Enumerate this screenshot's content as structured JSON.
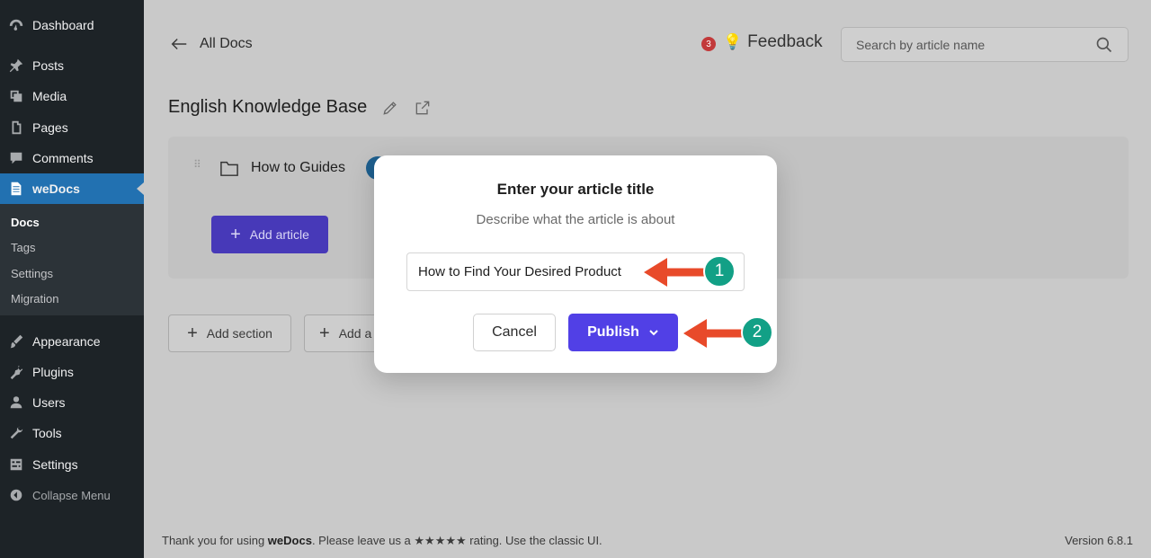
{
  "sidebar": {
    "items": [
      {
        "label": "Dashboard",
        "icon": "dashboard-icon"
      },
      {
        "label": "Posts",
        "icon": "pin-icon"
      },
      {
        "label": "Media",
        "icon": "media-icon"
      },
      {
        "label": "Pages",
        "icon": "pages-icon"
      },
      {
        "label": "Comments",
        "icon": "comment-icon"
      },
      {
        "label": "weDocs",
        "icon": "document-icon"
      },
      {
        "label": "Appearance",
        "icon": "brush-icon"
      },
      {
        "label": "Plugins",
        "icon": "plug-icon"
      },
      {
        "label": "Users",
        "icon": "user-icon"
      },
      {
        "label": "Tools",
        "icon": "wrench-icon"
      },
      {
        "label": "Settings",
        "icon": "settings-icon"
      }
    ],
    "submenu": [
      "Docs",
      "Tags",
      "Settings",
      "Migration"
    ],
    "collapse_label": "Collapse Menu"
  },
  "header": {
    "back_label": "All Docs",
    "feedback_count": "3",
    "feedback_label": "Feedback",
    "search_placeholder": "Search by article name"
  },
  "kb": {
    "title": "English Knowledge Base",
    "section_title": "How to Guides",
    "add_article_label": "Add article",
    "add_section_label": "Add section",
    "add_other_label": "Add a"
  },
  "modal": {
    "title": "Enter your article title",
    "subtitle": "Describe what the article is about",
    "input_value": "How to Find Your Desired Product",
    "cancel_label": "Cancel",
    "publish_label": "Publish"
  },
  "annotations": [
    "1",
    "2"
  ],
  "footer": {
    "thanks_prefix": "Thank you for using ",
    "brand": "weDocs",
    "thanks_suffix": ". Please leave us a ★★★★★ rating. Use the classic UI.",
    "version": "Version 6.8.1"
  },
  "colors": {
    "sidebar_bg": "#1d2327",
    "active_menu": "#2271b1",
    "primary": "#5140e6",
    "annotation_arrow": "#e84a2a",
    "annotation_badge": "#12a086"
  }
}
